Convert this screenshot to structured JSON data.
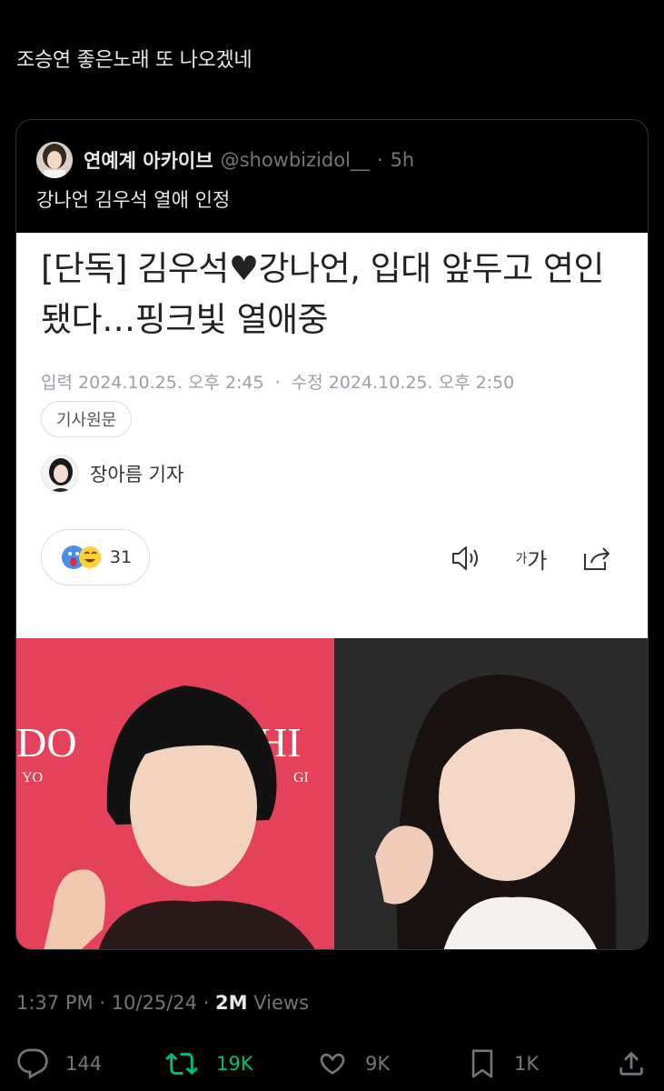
{
  "tweet": {
    "text": "조승연 좋은노래 또 나오겠네",
    "time": "1:37 PM",
    "date": "10/25/24",
    "views_count": "2M",
    "views_label": "Views"
  },
  "quote": {
    "name": "연예계 아카이브",
    "handle": "@showbizidol__",
    "time": "5h",
    "text": "강나언 김우석 열애 인정"
  },
  "article": {
    "title": "[단독] 김우석♥강나언, 입대 앞두고 연인됐다…핑크빛 열애중",
    "published_label": "입력",
    "published": "2024.10.25. 오후 2:45",
    "modified_label": "수정",
    "modified": "2024.10.25. 오후 2:50",
    "source_button": "기사원문",
    "reporter": "장아름 기자",
    "reaction_count": "31",
    "fontsize_label_small": "가",
    "fontsize_label_large": "가"
  },
  "actions": {
    "replies": "144",
    "retweets": "19K",
    "likes": "9K",
    "bookmarks": "1K"
  },
  "colors": {
    "background": "#000000",
    "text": "#e7e9ea",
    "muted": "#71767b",
    "retweet": "#00ba7c"
  }
}
